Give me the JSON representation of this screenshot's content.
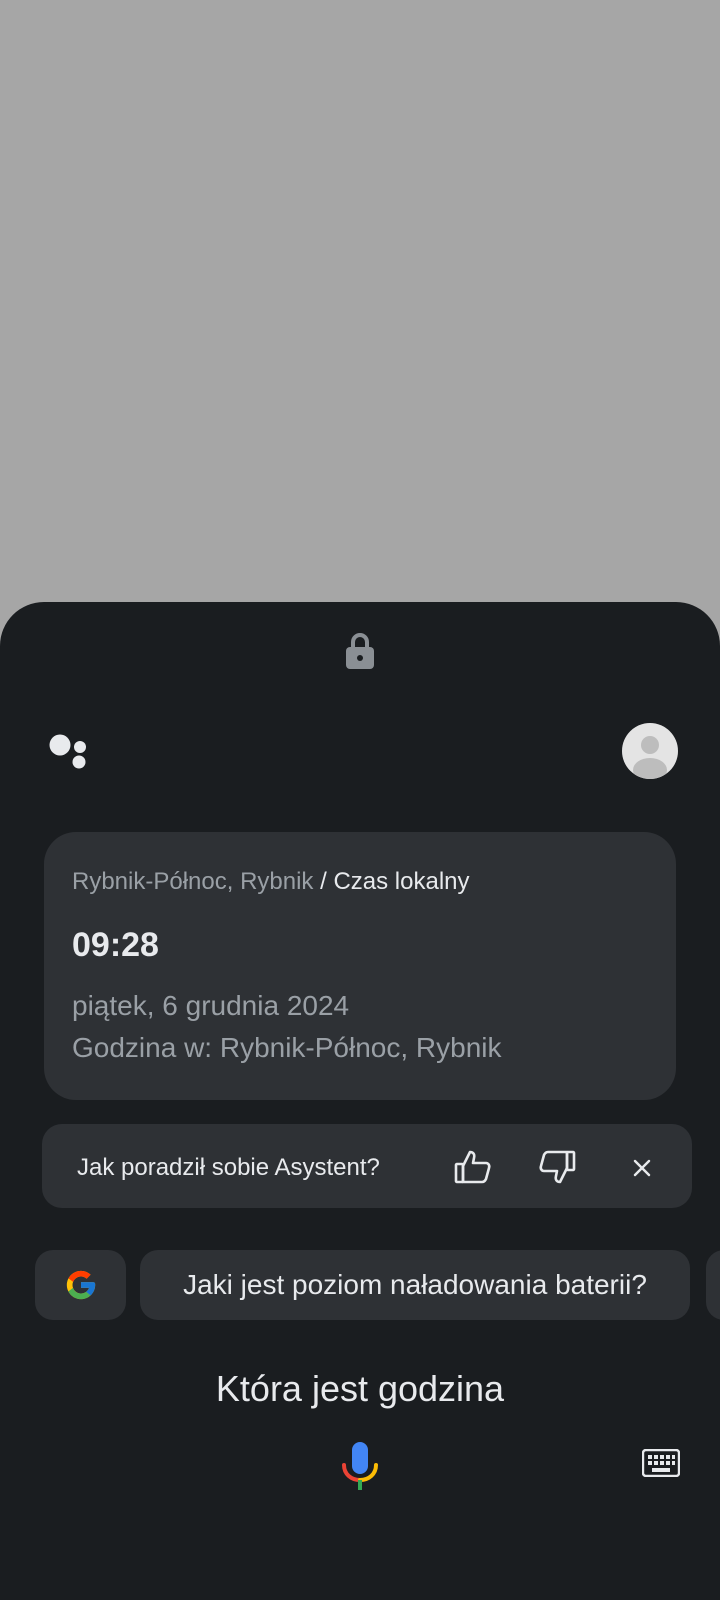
{
  "assistant": {
    "logo_icon": "google-assistant-logo-icon",
    "lock_icon": "lock-icon",
    "avatar_icon": "account-avatar-icon"
  },
  "time_card": {
    "location": "Rybnik-Północ, Rybnik",
    "separator_title": "/ Czas lokalny",
    "time": "09:28",
    "date": "piątek, 6 grudnia 2024",
    "timezone_label": "Godzina w: Rybnik-Północ, Rybnik"
  },
  "feedback": {
    "question": "Jak poradził sobie Asystent?",
    "thumbs_up_icon": "thumbs-up-icon",
    "thumbs_down_icon": "thumbs-down-icon",
    "close_icon": "close-icon"
  },
  "suggestions": {
    "google_icon": "google-g-icon",
    "chip_1": "Jaki jest poziom naładowania baterii?"
  },
  "query": {
    "text": "Która jest godzina"
  },
  "input": {
    "mic_icon": "microphone-icon",
    "keyboard_icon": "keyboard-icon"
  },
  "colors": {
    "sheet_bg": "#1a1d20",
    "card_bg": "#2e3135",
    "primary_text": "#e8eaed",
    "secondary_text": "#9aa0a6",
    "scrim": "#a6a6a6"
  }
}
